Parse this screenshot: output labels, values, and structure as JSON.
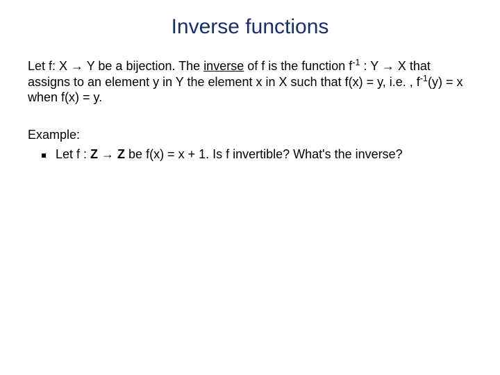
{
  "title": "Inverse functions",
  "definition": {
    "part1": "Let  f: X ",
    "arrow1": "→",
    "part2": " Y be a bijection.  The ",
    "inverseWord": "inverse",
    "part3": " of f is the function f",
    "sup1": "-1",
    "part4": " : Y ",
    "arrow2": "→",
    "part5": " X that assigns to an element y in Y the element x in X such that f(x) = y, i.e. , f",
    "sup2": "-1",
    "part6": "(y) = x when f(x) = y."
  },
  "exampleLabel": "Example:",
  "bullet": {
    "part1": "Let f : ",
    "z1": "Z",
    "arrow": " → ",
    "z2": "Z",
    "part2": " be f(x) = x + 1.  Is f invertible?  What's the inverse?"
  }
}
